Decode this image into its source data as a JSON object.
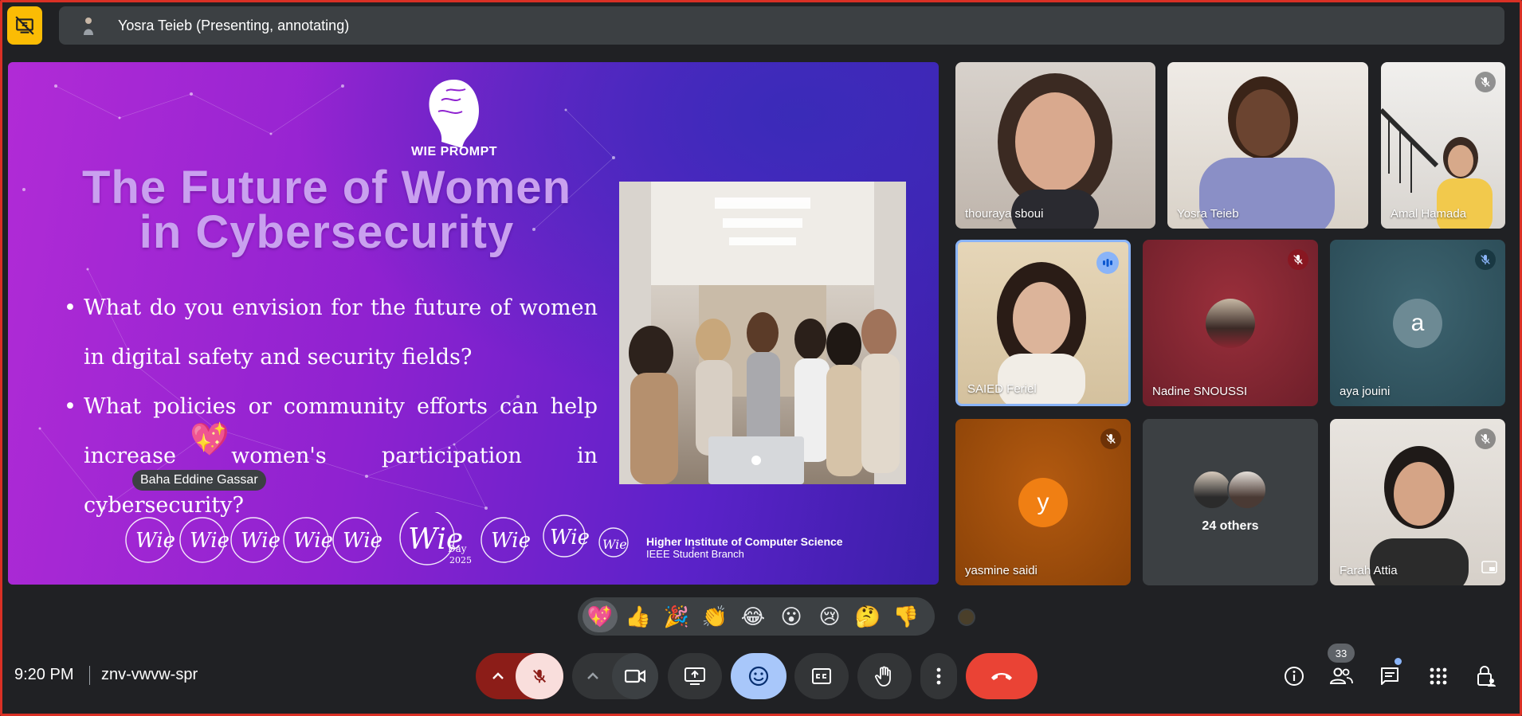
{
  "presentation": {
    "presenter_banner": "Yosra Teieb (Presenting, annotating)"
  },
  "slide": {
    "logo_text": "WIE PROMPT",
    "title_line1": "The Future of Women",
    "title_line2": "in Cybersecurity",
    "bullets": [
      "What do you envision for the future of women in digital safety and security fields?",
      "What policies or community efforts can help increase women's participation in cybersecurity?"
    ],
    "annotation_label": "Baha Eddine Gassar",
    "annotation_emoji": "💖",
    "footer_school": "Higher Institute of Computer Science",
    "footer_branch": "IEEE Student Branch",
    "footer_event_day": "Day",
    "footer_event_year": "2025"
  },
  "participants": [
    {
      "name": "thouraya sboui",
      "muted": false
    },
    {
      "name": "Yosra Teieb",
      "muted": false
    },
    {
      "name": "Amal Hamada",
      "muted": true
    },
    {
      "name": "SAIED Feriel",
      "muted": false,
      "speaking": true
    },
    {
      "name": "Nadine SNOUSSI",
      "muted": true
    },
    {
      "name": "aya jouini",
      "muted": true,
      "avatar_letter": "a"
    },
    {
      "name": "yasmine saidi",
      "muted": true,
      "avatar_letter": "y"
    },
    {
      "name": "Farah Attia",
      "muted": true
    }
  ],
  "others": {
    "label": "24 others"
  },
  "reactions": [
    "💖",
    "👍",
    "🎉",
    "👏",
    "😂",
    "😮",
    "😢",
    "🤔",
    "👎"
  ],
  "meeting": {
    "time": "9:20 PM",
    "code": "znv-vwvw-spr",
    "participant_count": "33"
  },
  "colors": {
    "end_call": "#ea4335",
    "mic_muted_bg": "#f9dedc",
    "emoji_active_bg": "#a8c7fa",
    "presenting_accent": "#fbbc04",
    "frame_border": "#d93025"
  }
}
